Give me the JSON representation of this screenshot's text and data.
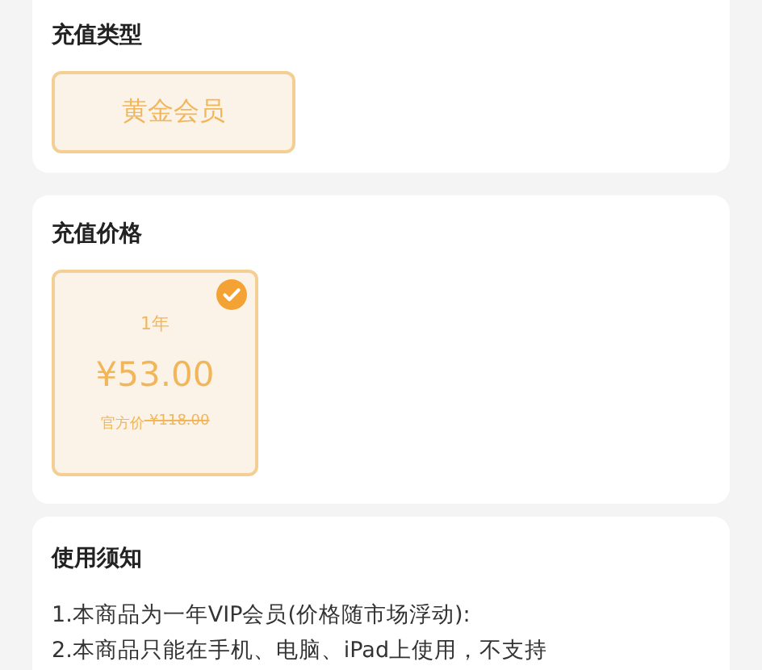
{
  "recharge_type": {
    "title": "充值类型",
    "options": [
      {
        "label": "黄金会员",
        "selected": true
      }
    ]
  },
  "recharge_price": {
    "title": "充值价格",
    "options": [
      {
        "period": "1年",
        "price": "¥53.00",
        "official_label": "官方价",
        "official_price": "-¥118.00",
        "selected": true
      }
    ]
  },
  "notice": {
    "title": "使用须知",
    "lines": [
      "1.本商品为一年VIP会员(价格随市场浮动):",
      "2.本商品只能在手机、电脑、iPad上使用，不支持"
    ]
  }
}
